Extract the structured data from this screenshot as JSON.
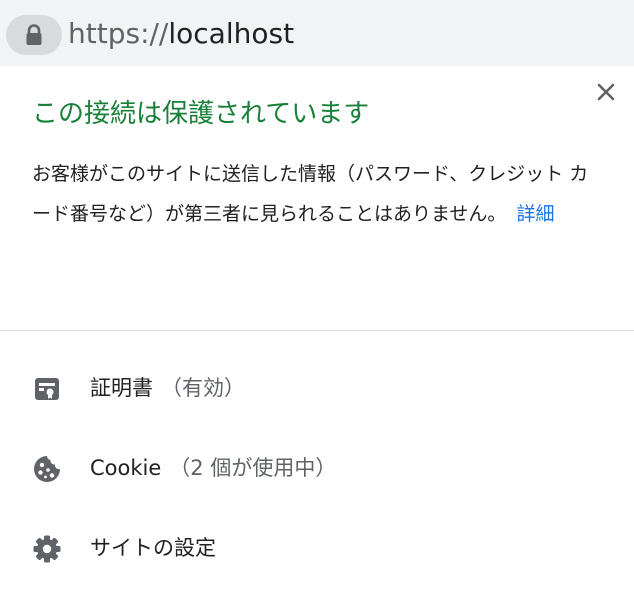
{
  "address_bar": {
    "url_scheme": "https://",
    "url_host": "localhost",
    "lock_icon": "lock-icon"
  },
  "popup": {
    "title": "この接続は保護されています",
    "description": "お客様がこのサイトに送信した情報（パスワード、クレジット カード番号など）が第三者に見られることはありません。",
    "details_link": "詳細",
    "close_icon": "close-icon",
    "menu": [
      {
        "icon": "certificate-icon",
        "label": "証明書",
        "status": "（有効）"
      },
      {
        "icon": "cookie-icon",
        "label": "Cookie",
        "status": "（2 個が使用中）"
      },
      {
        "icon": "gear-icon",
        "label": "サイトの設定",
        "status": ""
      }
    ]
  },
  "colors": {
    "secure_green": "#188038",
    "link_blue": "#1a73e8",
    "text_primary": "#202124",
    "text_secondary": "#5f6368",
    "icon_gray": "#5f6368",
    "address_bar_bg": "#f1f3f4",
    "lock_chip_bg": "#d8dadc"
  }
}
